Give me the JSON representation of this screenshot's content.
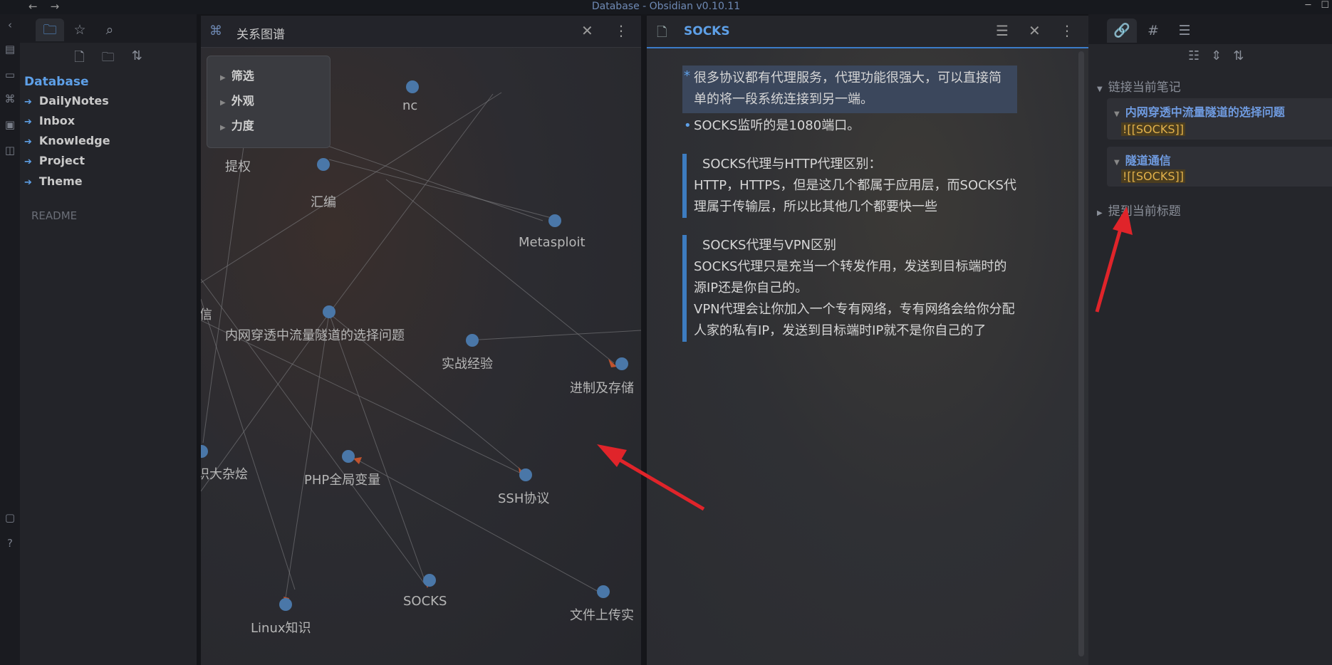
{
  "window": {
    "title": "Database - Obsidian v0.10.11",
    "back_icon": "←",
    "forward_icon": "→",
    "minimize_icon": "─",
    "maximize_icon": "☐"
  },
  "left_sidebar": {
    "vault_name": "Database",
    "folders": [
      "DailyNotes",
      "Inbox",
      "Knowledge",
      "Project",
      "Theme"
    ],
    "files": [
      "README"
    ]
  },
  "graph_view": {
    "title": "关系图谱",
    "controls": [
      "筛选",
      "外观",
      "力度"
    ],
    "nodes": [
      {
        "label": "nc"
      },
      {
        "label": "提权"
      },
      {
        "label": "汇编"
      },
      {
        "label": "Metasploit"
      },
      {
        "label": "信"
      },
      {
        "label": "内网穿透中流量隧道的选择问题"
      },
      {
        "label": "实战经验"
      },
      {
        "label": "进制及存储"
      },
      {
        "label": "识大杂烩"
      },
      {
        "label": "PHP全局变量"
      },
      {
        "label": "SSH协议"
      },
      {
        "label": "SOCKS"
      },
      {
        "label": "文件上传实"
      },
      {
        "label": "Linux知识"
      }
    ]
  },
  "note": {
    "title": "SOCKS",
    "bullets": [
      "很多协议都有代理服务，代理功能很强大，可以直接简单的将一段系统连接到另一端。",
      "SOCKS监听的是1080端口。"
    ],
    "callouts": [
      {
        "heading": "SOCKS代理与HTTP代理区别：",
        "lines": [
          "HTTP，HTTPS，但是这几个都属于应用层，而SOCKS代理属于传输层，所以比其他几个都要快一些"
        ]
      },
      {
        "heading": "SOCKS代理与VPN区别",
        "lines": [
          "SOCKS代理只是充当一个转发作用，发送到目标端时的源IP还是你自己的。",
          "VPN代理会让你加入一个专有网络，专有网络会给你分配人家的私有IP，发送到目标端时IP就不是你自己的了"
        ]
      }
    ]
  },
  "backlinks": {
    "linked_heading": "链接当前笔记",
    "items": [
      {
        "title": "内网穿透中流量隧道的选择问题",
        "snippet": "![[SOCKS]]"
      },
      {
        "title": "隧道通信",
        "snippet": "![[SOCKS]]"
      }
    ],
    "unlinked_heading": "提到当前标题"
  },
  "colors": {
    "accent": "#5ea0e8",
    "node": "#4a77a8",
    "annotation_arrow": "#e0242a"
  }
}
